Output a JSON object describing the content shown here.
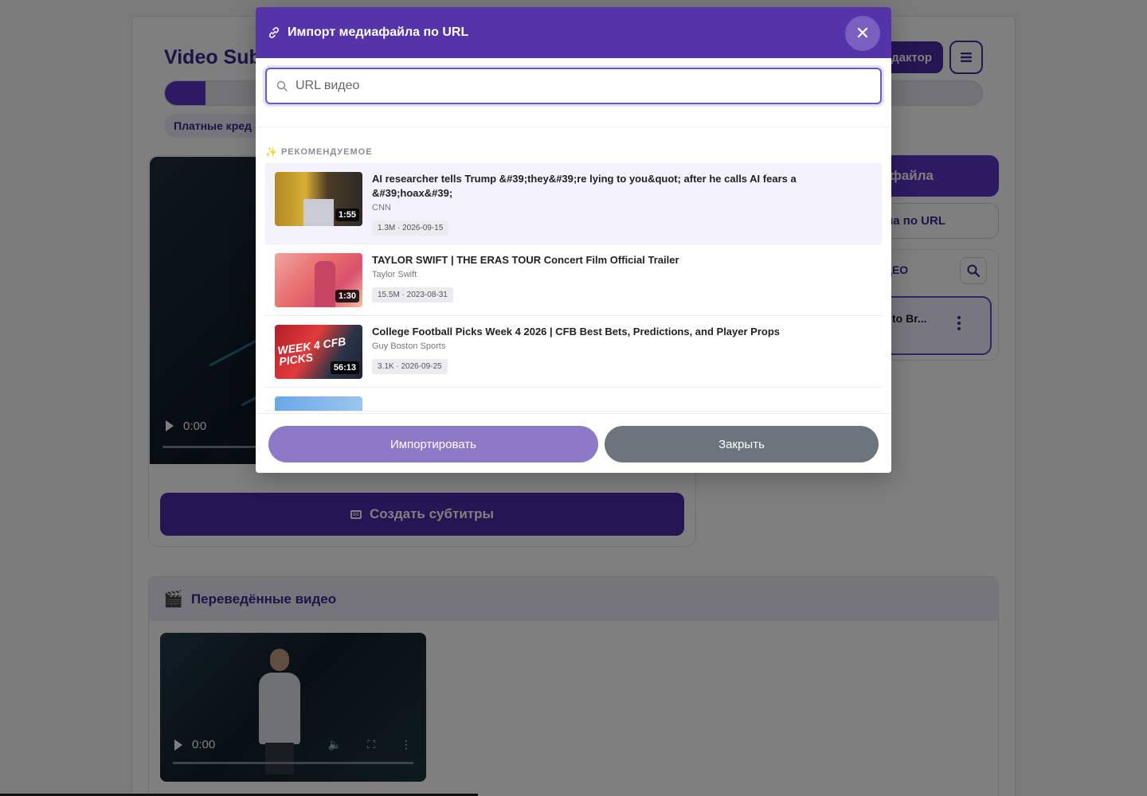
{
  "app": {
    "title": "Video Sub",
    "editor_label": "дактор",
    "progress_percent": 5,
    "credits_label": "Платные кред"
  },
  "player": {
    "time": "0:00"
  },
  "create_button": {
    "label": "Создать субтитры"
  },
  "sidebar": {
    "upload_label": "файла",
    "url_label": "ла по URL",
    "panel_title": "ДЕО",
    "item_label": "to Br..."
  },
  "translated": {
    "title": "Переведённые видео",
    "time": "0:00"
  },
  "modal": {
    "title": "Импорт медиафайла по URL",
    "close_symbol": "✕",
    "search": {
      "placeholder": "URL видео",
      "value": ""
    },
    "recommended_label": "РЕКОМЕНДУЕМОЕ",
    "results": [
      {
        "title": "AI researcher tells Trump &#39;they&#39;re lying to you&quot; after he calls AI fears a &#39;hoax&#39;",
        "channel": "CNN",
        "duration": "1:55",
        "stats": "1.3M · 2026-09-15"
      },
      {
        "title": "TAYLOR SWIFT | THE ERAS TOUR Concert Film Official Trailer",
        "channel": "Taylor Swift",
        "duration": "1:30",
        "stats": "15.5M · 2023-08-31"
      },
      {
        "title": "College Football Picks Week 4 2026 | CFB Best Bets, Predictions, and Player Props",
        "channel": "Guy Boston Sports",
        "duration": "56:13",
        "stats": "3.1K · 2026-09-25",
        "thumb_text": "WEEK 4 CFB PICKS"
      }
    ],
    "import_label": "Импортировать",
    "close_label": "Закрыть"
  }
}
